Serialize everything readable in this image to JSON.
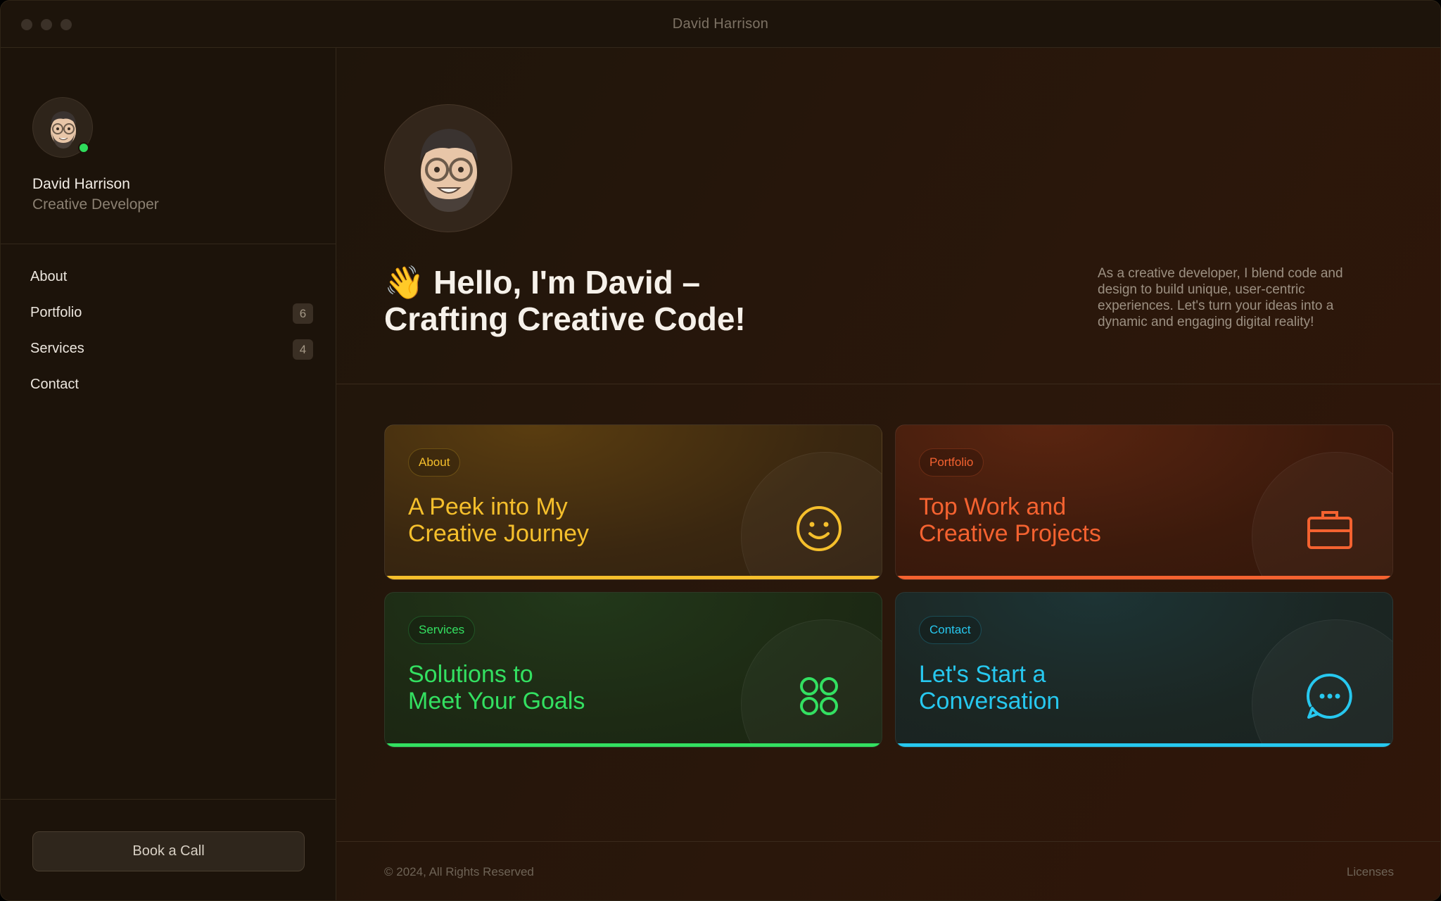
{
  "window": {
    "title": "David Harrison"
  },
  "sidebar": {
    "name": "David Harrison",
    "role": "Creative Developer",
    "nav": [
      {
        "label": "About",
        "badge": ""
      },
      {
        "label": "Portfolio",
        "badge": "6"
      },
      {
        "label": "Services",
        "badge": "4"
      },
      {
        "label": "Contact",
        "badge": ""
      }
    ],
    "cta_label": "Book a Call"
  },
  "hero": {
    "emoji": "👋",
    "title_line1": "Hello, I'm David –",
    "title_line2": "Crafting Creative Code!",
    "description": "As a creative developer, I blend code and design to build unique, user-centric experiences. Let's turn your ideas into a dynamic and engaging digital reality!"
  },
  "cards": [
    {
      "tag": "About",
      "title_line1": "A Peek into My",
      "title_line2": "Creative Journey",
      "icon": "smiley-icon",
      "color": "#f5bf2c"
    },
    {
      "tag": "Portfolio",
      "title_line1": "Top Work and",
      "title_line2": "Creative Projects",
      "icon": "briefcase-icon",
      "color": "#f46230"
    },
    {
      "tag": "Services",
      "title_line1": "Solutions to",
      "title_line2": "Meet Your Goals",
      "icon": "four-circles-icon",
      "color": "#33e061"
    },
    {
      "tag": "Contact",
      "title_line1": "Let's Start a",
      "title_line2": "Conversation",
      "icon": "chat-bubble-icon",
      "color": "#27c8ef"
    }
  ],
  "footer": {
    "copyright": "© 2024, All Rights Reserved",
    "licenses": "Licenses"
  }
}
